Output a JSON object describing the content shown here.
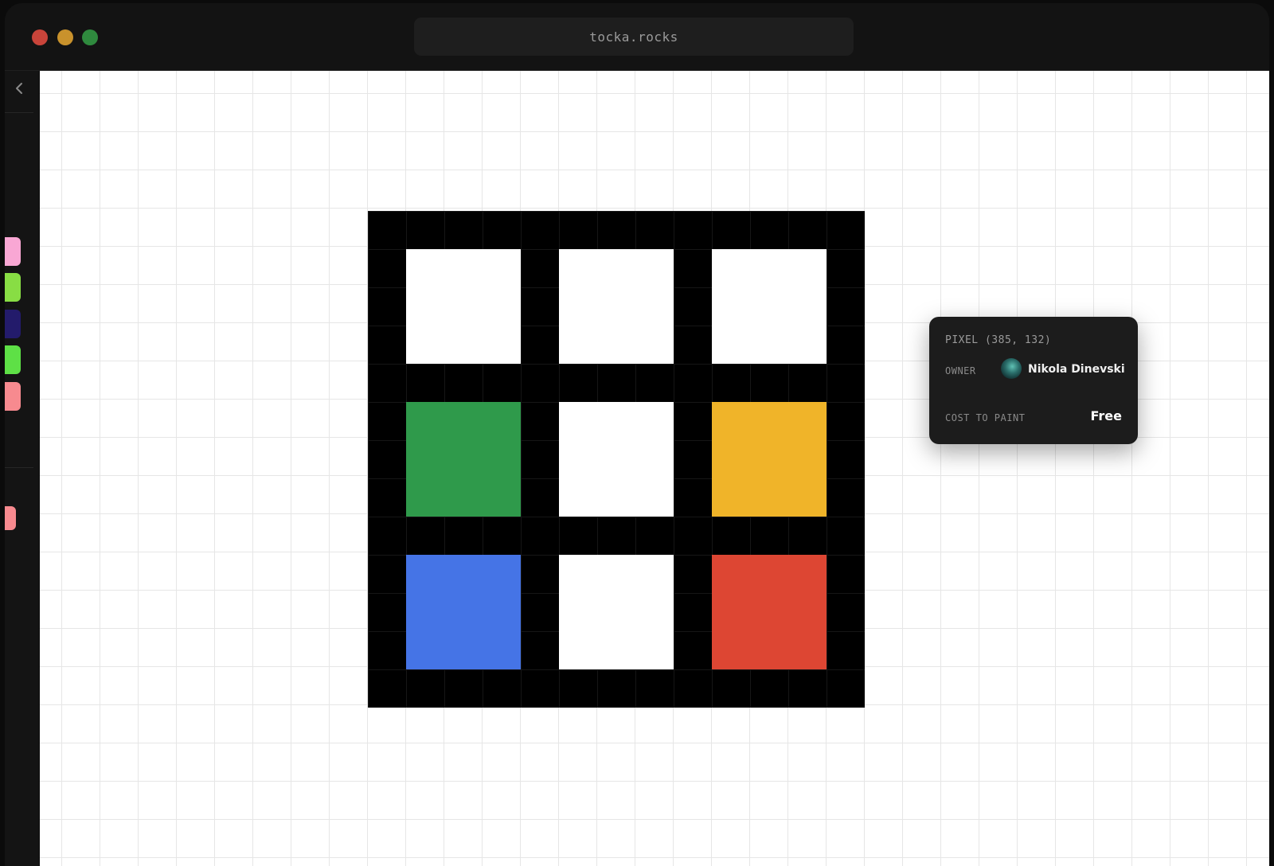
{
  "window": {
    "url": "tocka.rocks",
    "traffic_lights": {
      "close": "#c9443a",
      "minimize": "#c9922c",
      "zoom": "#2f8a3e"
    }
  },
  "sidebar": {
    "back_icon": "chevron-left-icon",
    "swatches": [
      {
        "color": "#f9a7d4"
      },
      {
        "color": "#88dd44"
      },
      {
        "color": "#231b6b"
      },
      {
        "color": "#5ee046"
      },
      {
        "color": "#f78a8f"
      }
    ],
    "extra_swatches": [
      {
        "color": "#f78a8f"
      }
    ]
  },
  "canvas": {
    "artwork_border_color": "#000000",
    "grid": [
      [
        "#ffffff",
        "#ffffff",
        "#ffffff"
      ],
      [
        "#2f9a4b",
        "#ffffff",
        "#f0b429"
      ],
      [
        "#4574e6",
        "#ffffff",
        "#dd4633"
      ]
    ]
  },
  "tooltip": {
    "pixel_label": "PIXEL (385, 132)",
    "owner_label": "OWNER",
    "owner_name": "Nikola Dinevski",
    "cost_label": "COST TO PAINT",
    "cost_value": "Free"
  }
}
